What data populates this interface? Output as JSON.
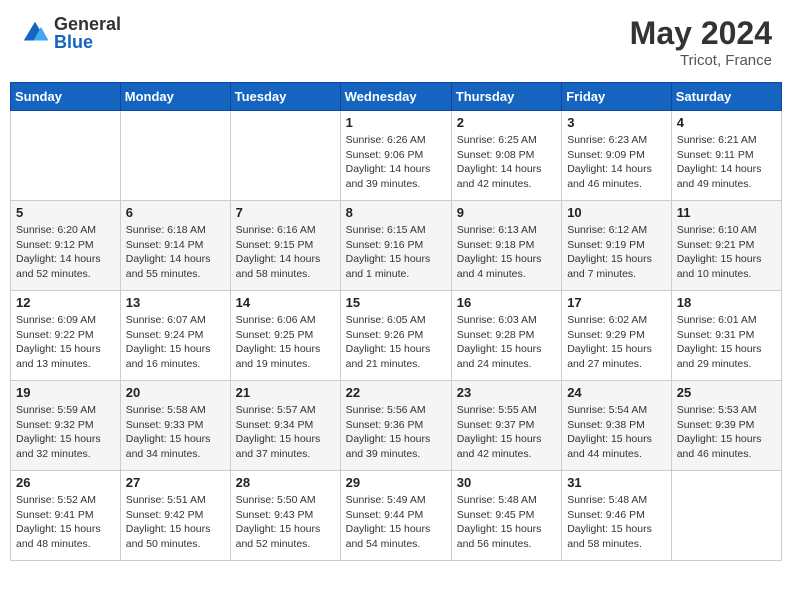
{
  "header": {
    "logo_general": "General",
    "logo_blue": "Blue",
    "month_year": "May 2024",
    "location": "Tricot, France"
  },
  "days_of_week": [
    "Sunday",
    "Monday",
    "Tuesday",
    "Wednesday",
    "Thursday",
    "Friday",
    "Saturday"
  ],
  "weeks": [
    [
      {
        "day": "",
        "info": ""
      },
      {
        "day": "",
        "info": ""
      },
      {
        "day": "",
        "info": ""
      },
      {
        "day": "1",
        "info": "Sunrise: 6:26 AM\nSunset: 9:06 PM\nDaylight: 14 hours and 39 minutes."
      },
      {
        "day": "2",
        "info": "Sunrise: 6:25 AM\nSunset: 9:08 PM\nDaylight: 14 hours and 42 minutes."
      },
      {
        "day": "3",
        "info": "Sunrise: 6:23 AM\nSunset: 9:09 PM\nDaylight: 14 hours and 46 minutes."
      },
      {
        "day": "4",
        "info": "Sunrise: 6:21 AM\nSunset: 9:11 PM\nDaylight: 14 hours and 49 minutes."
      }
    ],
    [
      {
        "day": "5",
        "info": "Sunrise: 6:20 AM\nSunset: 9:12 PM\nDaylight: 14 hours and 52 minutes."
      },
      {
        "day": "6",
        "info": "Sunrise: 6:18 AM\nSunset: 9:14 PM\nDaylight: 14 hours and 55 minutes."
      },
      {
        "day": "7",
        "info": "Sunrise: 6:16 AM\nSunset: 9:15 PM\nDaylight: 14 hours and 58 minutes."
      },
      {
        "day": "8",
        "info": "Sunrise: 6:15 AM\nSunset: 9:16 PM\nDaylight: 15 hours and 1 minute."
      },
      {
        "day": "9",
        "info": "Sunrise: 6:13 AM\nSunset: 9:18 PM\nDaylight: 15 hours and 4 minutes."
      },
      {
        "day": "10",
        "info": "Sunrise: 6:12 AM\nSunset: 9:19 PM\nDaylight: 15 hours and 7 minutes."
      },
      {
        "day": "11",
        "info": "Sunrise: 6:10 AM\nSunset: 9:21 PM\nDaylight: 15 hours and 10 minutes."
      }
    ],
    [
      {
        "day": "12",
        "info": "Sunrise: 6:09 AM\nSunset: 9:22 PM\nDaylight: 15 hours and 13 minutes."
      },
      {
        "day": "13",
        "info": "Sunrise: 6:07 AM\nSunset: 9:24 PM\nDaylight: 15 hours and 16 minutes."
      },
      {
        "day": "14",
        "info": "Sunrise: 6:06 AM\nSunset: 9:25 PM\nDaylight: 15 hours and 19 minutes."
      },
      {
        "day": "15",
        "info": "Sunrise: 6:05 AM\nSunset: 9:26 PM\nDaylight: 15 hours and 21 minutes."
      },
      {
        "day": "16",
        "info": "Sunrise: 6:03 AM\nSunset: 9:28 PM\nDaylight: 15 hours and 24 minutes."
      },
      {
        "day": "17",
        "info": "Sunrise: 6:02 AM\nSunset: 9:29 PM\nDaylight: 15 hours and 27 minutes."
      },
      {
        "day": "18",
        "info": "Sunrise: 6:01 AM\nSunset: 9:31 PM\nDaylight: 15 hours and 29 minutes."
      }
    ],
    [
      {
        "day": "19",
        "info": "Sunrise: 5:59 AM\nSunset: 9:32 PM\nDaylight: 15 hours and 32 minutes."
      },
      {
        "day": "20",
        "info": "Sunrise: 5:58 AM\nSunset: 9:33 PM\nDaylight: 15 hours and 34 minutes."
      },
      {
        "day": "21",
        "info": "Sunrise: 5:57 AM\nSunset: 9:34 PM\nDaylight: 15 hours and 37 minutes."
      },
      {
        "day": "22",
        "info": "Sunrise: 5:56 AM\nSunset: 9:36 PM\nDaylight: 15 hours and 39 minutes."
      },
      {
        "day": "23",
        "info": "Sunrise: 5:55 AM\nSunset: 9:37 PM\nDaylight: 15 hours and 42 minutes."
      },
      {
        "day": "24",
        "info": "Sunrise: 5:54 AM\nSunset: 9:38 PM\nDaylight: 15 hours and 44 minutes."
      },
      {
        "day": "25",
        "info": "Sunrise: 5:53 AM\nSunset: 9:39 PM\nDaylight: 15 hours and 46 minutes."
      }
    ],
    [
      {
        "day": "26",
        "info": "Sunrise: 5:52 AM\nSunset: 9:41 PM\nDaylight: 15 hours and 48 minutes."
      },
      {
        "day": "27",
        "info": "Sunrise: 5:51 AM\nSunset: 9:42 PM\nDaylight: 15 hours and 50 minutes."
      },
      {
        "day": "28",
        "info": "Sunrise: 5:50 AM\nSunset: 9:43 PM\nDaylight: 15 hours and 52 minutes."
      },
      {
        "day": "29",
        "info": "Sunrise: 5:49 AM\nSunset: 9:44 PM\nDaylight: 15 hours and 54 minutes."
      },
      {
        "day": "30",
        "info": "Sunrise: 5:48 AM\nSunset: 9:45 PM\nDaylight: 15 hours and 56 minutes."
      },
      {
        "day": "31",
        "info": "Sunrise: 5:48 AM\nSunset: 9:46 PM\nDaylight: 15 hours and 58 minutes."
      },
      {
        "day": "",
        "info": ""
      }
    ]
  ]
}
